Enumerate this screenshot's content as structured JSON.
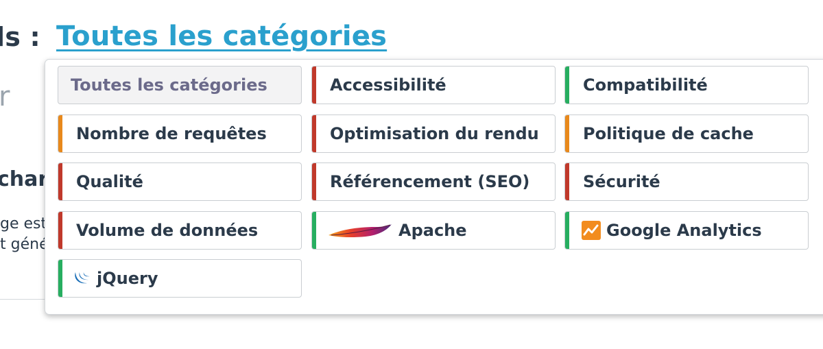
{
  "page": {
    "filter_prefix": "ls :",
    "filter_link": "Toutes les catégories",
    "background_fragments": [
      "r",
      "charg",
      "ge est",
      "t géné"
    ]
  },
  "colors": {
    "link": "#2aa0cd",
    "red": "#c0392b",
    "orange": "#e8891c",
    "green": "#27ae60"
  },
  "dropdown": {
    "items": [
      {
        "label": "Toutes les catégories",
        "selected": true,
        "stripe": "none"
      },
      {
        "label": "Accessibilité",
        "stripe": "red"
      },
      {
        "label": "Compatibilité",
        "stripe": "green"
      },
      {
        "label": "Nombre de requêtes",
        "stripe": "orange"
      },
      {
        "label": "Optimisation du rendu",
        "stripe": "red"
      },
      {
        "label": "Politique de cache",
        "stripe": "orange"
      },
      {
        "label": "Qualité",
        "stripe": "red"
      },
      {
        "label": "Référencement (SEO)",
        "stripe": "red"
      },
      {
        "label": "Sécurité",
        "stripe": "red"
      },
      {
        "label": "Volume de données",
        "stripe": "red"
      },
      {
        "label": "Apache",
        "stripe": "green",
        "icon": "apache-feather-icon"
      },
      {
        "label": "Google Analytics",
        "stripe": "green",
        "icon": "google-analytics-icon"
      },
      {
        "label": "jQuery",
        "stripe": "green",
        "icon": "jquery-icon"
      }
    ]
  }
}
